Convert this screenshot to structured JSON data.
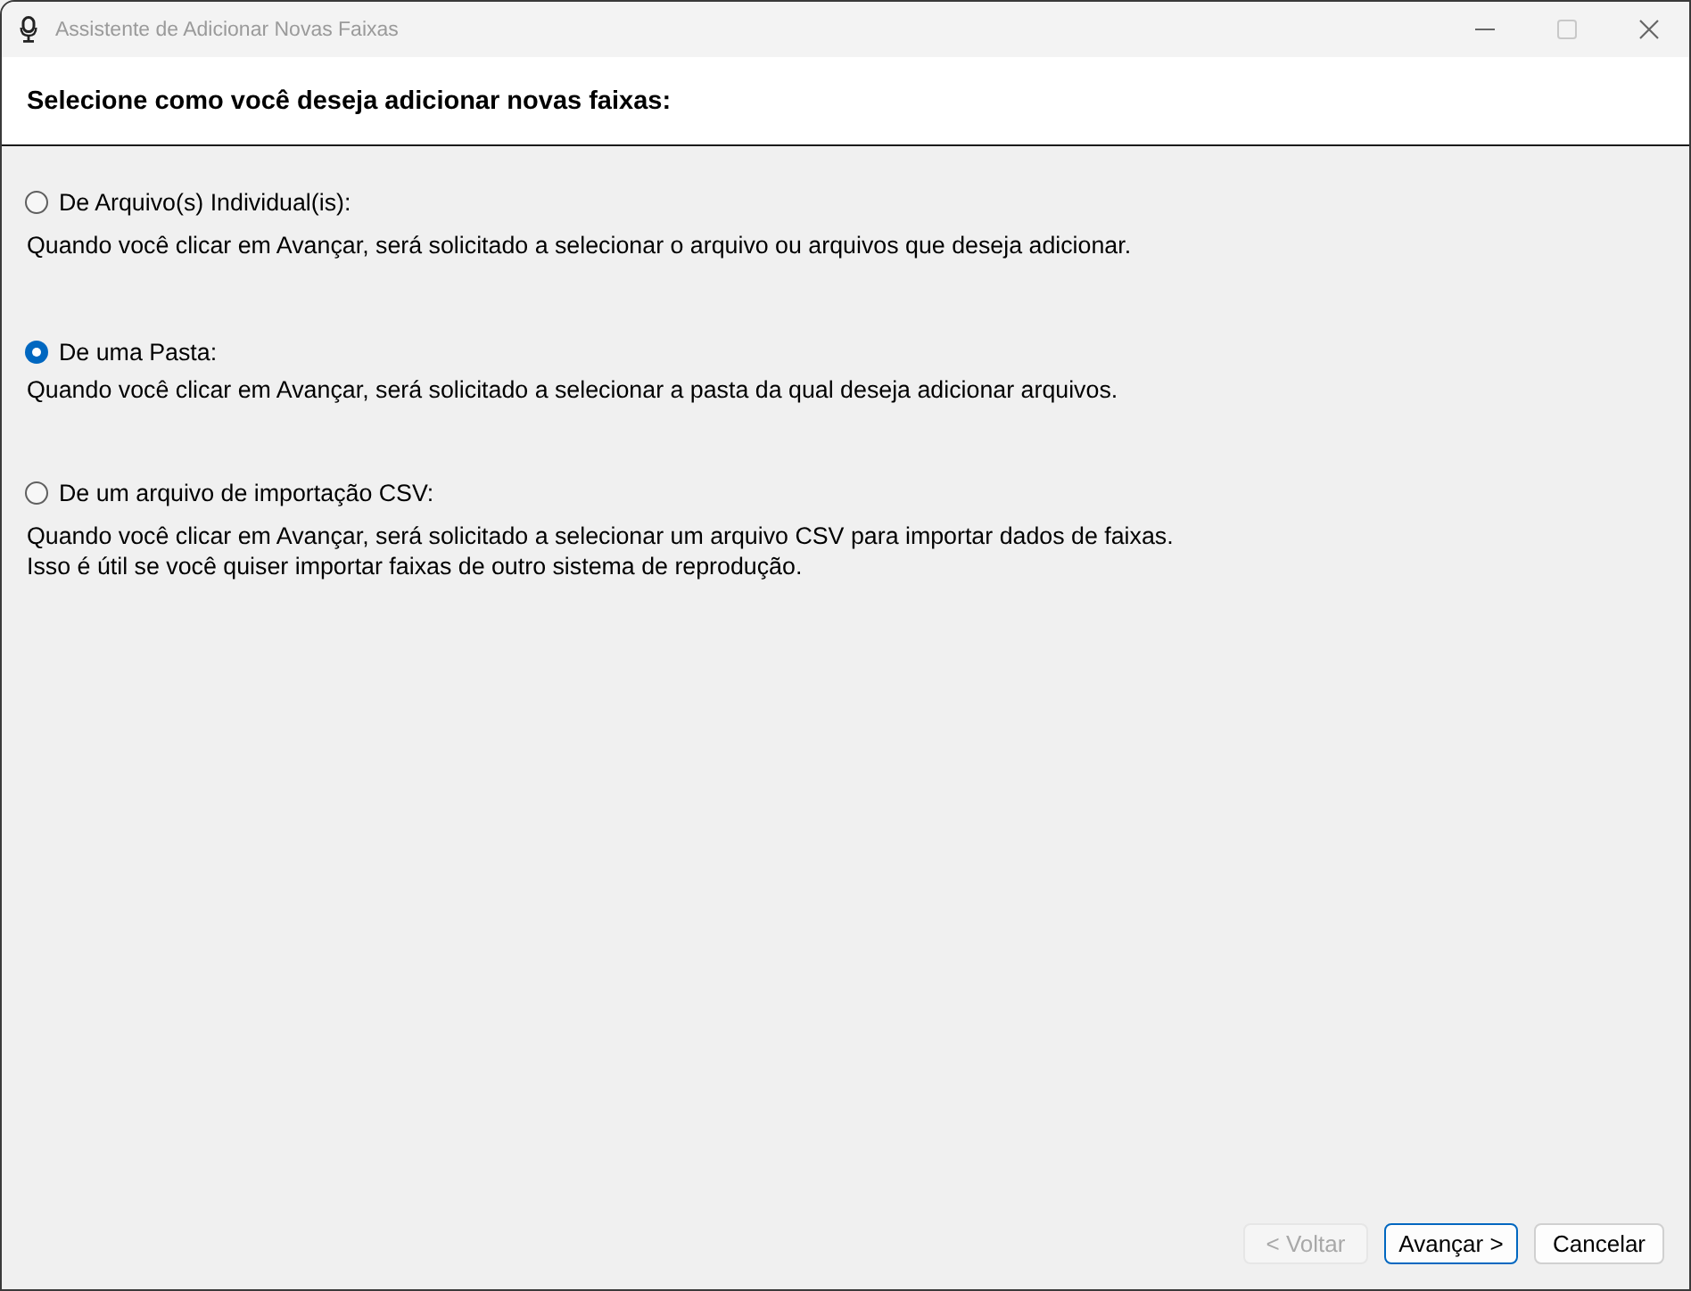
{
  "window": {
    "title": "Assistente de Adicionar Novas Faixas",
    "controls": [
      {
        "kind": "minimize",
        "disabled": false
      },
      {
        "kind": "maximize",
        "disabled": true
      },
      {
        "kind": "close",
        "disabled": false
      }
    ]
  },
  "header": {
    "title": "Selecione como você deseja adicionar novas faixas:"
  },
  "options": [
    {
      "label": "De Arquivo(s) Individual(is):",
      "selected": false,
      "description": [
        "Quando você clicar em Avançar, será solicitado a selecionar o arquivo ou arquivos que deseja adicionar."
      ]
    },
    {
      "label": "De uma Pasta:",
      "selected": true,
      "description": [
        "Quando você clicar em Avançar, será solicitado a selecionar a pasta da qual deseja adicionar arquivos."
      ]
    },
    {
      "label": "De um arquivo de importação CSV:",
      "selected": false,
      "description": [
        "Quando você clicar em Avançar, será solicitado a selecionar um arquivo CSV para importar dados de faixas.",
        "Isso é útil se você quiser importar faixas de outro sistema de reprodução."
      ]
    }
  ],
  "buttons": [
    {
      "label": "< Voltar",
      "disabled": true,
      "default": false
    },
    {
      "label": "Avançar >",
      "disabled": false,
      "default": true
    },
    {
      "label": "Cancelar",
      "disabled": false,
      "default": false
    }
  ]
}
